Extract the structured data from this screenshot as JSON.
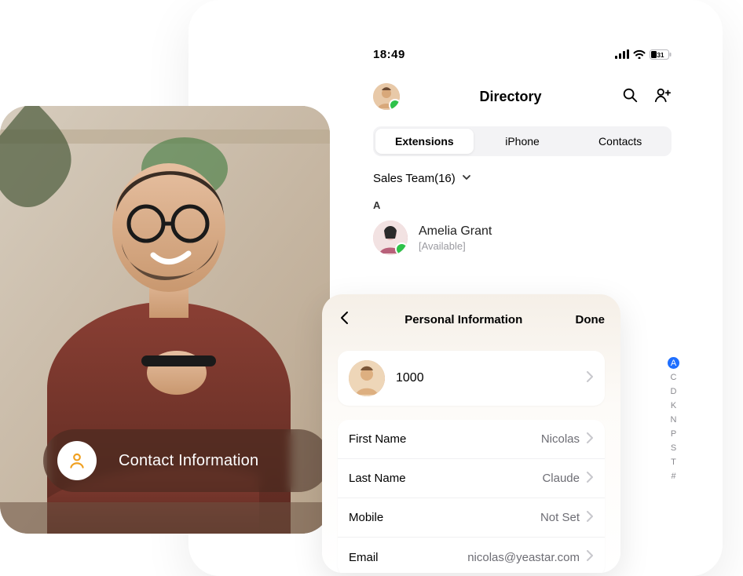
{
  "statusbar": {
    "time": "18:49",
    "battery": "31"
  },
  "header": {
    "title": "Directory"
  },
  "tabs": {
    "t0": "Extensions",
    "t1": "iPhone",
    "t2": "Contacts"
  },
  "group": {
    "label": "Sales Team(16)"
  },
  "section_letter": "A",
  "contact": {
    "name": "Amelia Grant",
    "status": "[Available]"
  },
  "index": [
    "A",
    "C",
    "D",
    "K",
    "N",
    "P",
    "S",
    "T",
    "#"
  ],
  "pill": {
    "label": "Contact Information"
  },
  "card": {
    "title": "Personal Information",
    "done": "Done",
    "extension": "1000",
    "fields": {
      "first_name": {
        "label": "First Name",
        "value": "Nicolas"
      },
      "last_name": {
        "label": "Last Name",
        "value": "Claude"
      },
      "mobile": {
        "label": "Mobile",
        "value": "Not Set"
      },
      "email": {
        "label": "Email",
        "value": "nicolas@yeastar.com"
      }
    }
  },
  "icons": {
    "search": "search-icon",
    "add_user": "add-user-icon",
    "back": "chevron-left-icon",
    "chevron": "chevron-right-icon",
    "down": "chevron-down-icon",
    "person": "person-icon"
  }
}
